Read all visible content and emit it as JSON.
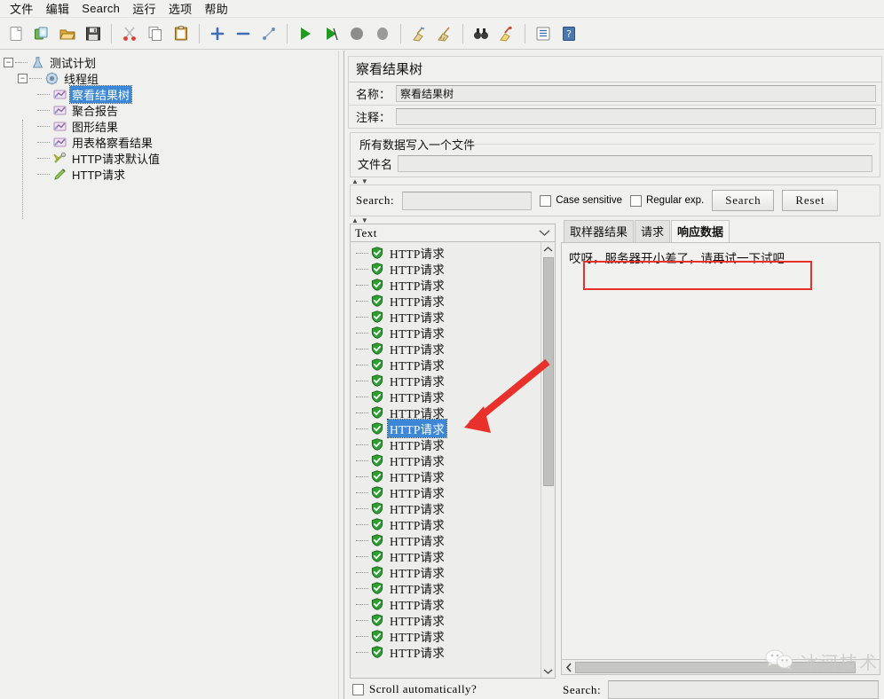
{
  "menu": {
    "items": [
      {
        "label": "文件",
        "name": "menu-file"
      },
      {
        "label": "编辑",
        "name": "menu-edit"
      },
      {
        "label": "Search",
        "name": "menu-search"
      },
      {
        "label": "运行",
        "name": "menu-run"
      },
      {
        "label": "选项",
        "name": "menu-options"
      },
      {
        "label": "帮助",
        "name": "menu-help"
      }
    ]
  },
  "toolbar": {
    "buttons": [
      {
        "icon": "new-document-icon"
      },
      {
        "icon": "templates-icon"
      },
      {
        "icon": "open-folder-icon"
      },
      {
        "icon": "save-icon"
      },
      {
        "sep": true
      },
      {
        "icon": "cut-scissors-icon"
      },
      {
        "icon": "copy-icon"
      },
      {
        "icon": "paste-clipboard-icon"
      },
      {
        "sep": true
      },
      {
        "icon": "expand-plus-icon"
      },
      {
        "icon": "collapse-minus-icon"
      },
      {
        "icon": "toggle-node-icon"
      },
      {
        "sep": true
      },
      {
        "icon": "start-play-icon"
      },
      {
        "icon": "start-no-timers-icon"
      },
      {
        "icon": "stop-icon"
      },
      {
        "icon": "shutdown-icon"
      },
      {
        "sep": true
      },
      {
        "icon": "clear-broom-icon"
      },
      {
        "icon": "clear-all-broom-icon"
      },
      {
        "sep": true
      },
      {
        "icon": "search-binoculars-icon"
      },
      {
        "icon": "search-reset-broom-icon"
      },
      {
        "sep": true
      },
      {
        "icon": "function-helper-icon"
      },
      {
        "icon": "help-question-icon"
      }
    ]
  },
  "tree": {
    "nodes": [
      {
        "label": "测试计划",
        "icon": "test-plan-icon",
        "depth": 0,
        "toggle": "−",
        "selected": false
      },
      {
        "label": "线程组",
        "icon": "thread-group-gear-icon",
        "depth": 1,
        "toggle": "−",
        "selected": false
      },
      {
        "label": "察看结果树",
        "icon": "listener-chart-icon",
        "depth": 2,
        "toggle": "",
        "selected": true
      },
      {
        "label": "聚合报告",
        "icon": "listener-chart-icon",
        "depth": 2,
        "toggle": "",
        "selected": false
      },
      {
        "label": "图形结果",
        "icon": "listener-chart-icon",
        "depth": 2,
        "toggle": "",
        "selected": false
      },
      {
        "label": "用表格察看结果",
        "icon": "listener-chart-icon",
        "depth": 2,
        "toggle": "",
        "selected": false
      },
      {
        "label": "HTTP请求默认值",
        "icon": "config-defaults-icon",
        "depth": 2,
        "toggle": "",
        "selected": false
      },
      {
        "label": "HTTP请求",
        "icon": "http-sampler-pencil-icon",
        "depth": 2,
        "toggle": "",
        "selected": false
      }
    ]
  },
  "panel": {
    "title": "察看结果树",
    "name_label": "名称：",
    "name_value": "察看结果树",
    "comment_label": "注释：",
    "comment_value": "",
    "group_title": "所有数据写入一个文件",
    "filename_label": "文件名",
    "filename_value": ""
  },
  "search_bar": {
    "label": "Search:",
    "value": "",
    "case_sensitive_label": "Case sensitive",
    "case_sensitive_checked": false,
    "regular_exp_label": "Regular exp.",
    "regular_exp_checked": false,
    "search_button": "Search",
    "reset_button": "Reset"
  },
  "results": {
    "renderer_selected": "Text",
    "renderer_options": [
      "Text"
    ],
    "item_label": "HTTP请求",
    "item_count": 26,
    "selected_index": 11,
    "status_icon": "green-shield-check-icon",
    "scroll_auto_label": "Scroll automatically?",
    "scroll_auto_checked": false
  },
  "detail": {
    "tabs": [
      {
        "label": "取样器结果",
        "active": false
      },
      {
        "label": "请求",
        "active": false
      },
      {
        "label": "响应数据",
        "active": true
      }
    ],
    "response_text": "哎呀，服务器开小差了，请再试一下试吧",
    "bottom_search_label": "Search:",
    "bottom_search_value": ""
  },
  "annotations": {
    "highlight_box_color": "#e8312a",
    "arrow_color": "#e8312a",
    "watermark_text": "冰河技术",
    "watermark_icon": "wechat-icon"
  }
}
